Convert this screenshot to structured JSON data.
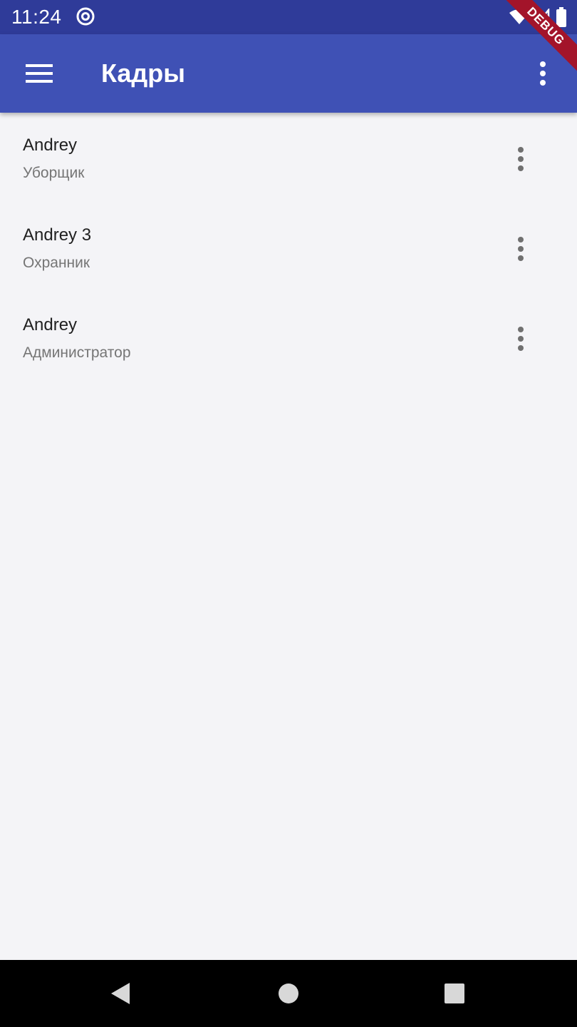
{
  "status_bar": {
    "time": "11:24",
    "icons": [
      "at-sign-icon",
      "wifi-icon",
      "signal-icon",
      "battery-icon"
    ]
  },
  "debug_banner": {
    "label": "DEBUG"
  },
  "app_bar": {
    "title": "Кадры",
    "menu_icon": "hamburger-menu-icon",
    "overflow_icon": "more-vert-icon"
  },
  "employees": [
    {
      "name": "Andrey",
      "position": "Уборщик"
    },
    {
      "name": "Andrey 3",
      "position": "Охранник"
    },
    {
      "name": "Andrey",
      "position": "Администратор"
    }
  ],
  "nav_bar": {
    "buttons": [
      "back-icon",
      "home-icon",
      "recents-icon"
    ]
  },
  "colors": {
    "app_bar": "#3f51b5",
    "status_bar": "#2f3b99",
    "background": "#f4f4f7",
    "debug_ribbon": "#a3142a"
  }
}
